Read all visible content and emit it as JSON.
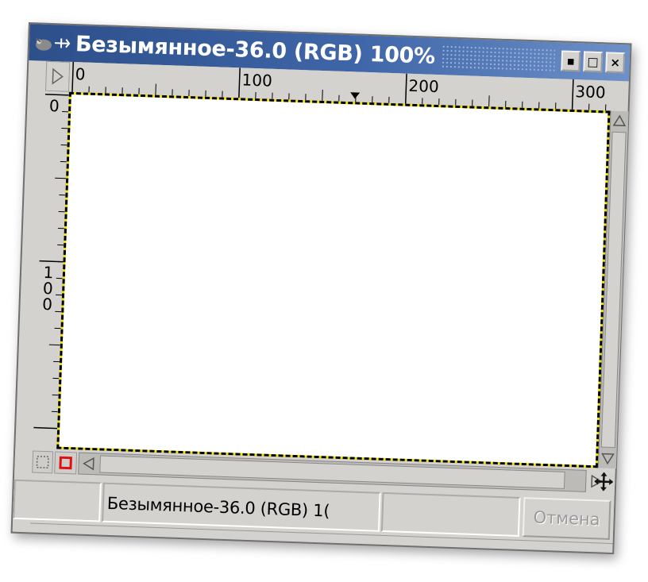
{
  "window": {
    "title": "Безымянное-36.0 (RGB) 100%",
    "buttons": {
      "menu_glyph": "▪",
      "maximize_glyph": "□",
      "close_glyph": "×"
    }
  },
  "rulers": {
    "horizontal": [
      "0",
      "100",
      "200",
      "300"
    ],
    "vertical": [
      "0",
      "1",
      "0",
      "0"
    ]
  },
  "status": {
    "image_label": "Безымянное-36.0 (RGB) 1(",
    "cancel_label": "Отмена"
  },
  "icons": {
    "title": "gimp-wilber-icon",
    "pin": "pin-icon",
    "menu_arrow": "triangle-right-icon",
    "qmask": "quick-mask-icon",
    "red_square": "selection-red-square-icon",
    "navigate": "move-cross-icon",
    "marker": "ruler-pointer-marker"
  },
  "colors": {
    "title_bar": "#2d4f8a",
    "selection_marching_ants": "#f0e000",
    "quick_mask_red": "#e01010"
  }
}
